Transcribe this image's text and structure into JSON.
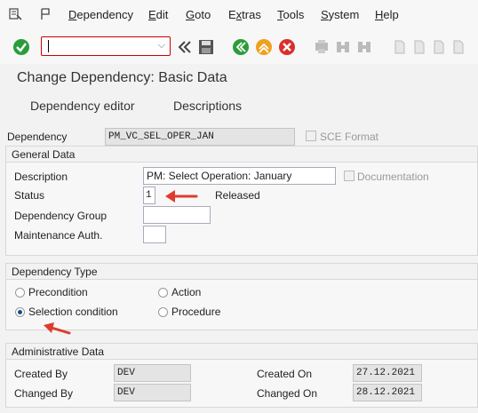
{
  "menubar": {
    "items": [
      "Dependency",
      "Edit",
      "Goto",
      "Extras",
      "Tools",
      "System",
      "Help"
    ],
    "underline": [
      "D",
      "E",
      "G",
      "x",
      "T",
      "S",
      "H"
    ]
  },
  "toolbar": {
    "command_value": "",
    "icons": [
      "enter-icon",
      "back-icon",
      "save-icon",
      "back-green-icon",
      "exit-icon",
      "cancel-icon",
      "find-icon",
      "find-next-icon",
      "page-icons"
    ]
  },
  "title": "Change Dependency: Basic Data",
  "app_toolbar": {
    "buttons": [
      "Dependency editor",
      "Descriptions"
    ]
  },
  "header": {
    "dependency_label": "Dependency",
    "dependency_value": "PM_VC_SEL_OPER_JAN",
    "sce_format_label": "SCE Format"
  },
  "general_data": {
    "title": "General Data",
    "description_label": "Description",
    "description_value": "PM: Select Operation: January",
    "documentation_label": "Documentation",
    "status_label": "Status",
    "status_value": "1",
    "status_text": "Released",
    "dependency_group_label": "Dependency Group",
    "dependency_group_value": "",
    "maintenance_auth_label": "Maintenance Auth.",
    "maintenance_auth_value": ""
  },
  "dependency_type": {
    "title": "Dependency Type",
    "options": [
      {
        "label": "Precondition",
        "selected": false
      },
      {
        "label": "Action",
        "selected": false
      },
      {
        "label": "Selection condition",
        "selected": true
      },
      {
        "label": "Procedure",
        "selected": false
      }
    ]
  },
  "admin_data": {
    "title": "Administrative Data",
    "created_by_label": "Created By",
    "created_by_value": "DEV",
    "changed_by_label": "Changed By",
    "changed_by_value": "DEV",
    "created_on_label": "Created On",
    "created_on_value": "27.12.2021",
    "changed_on_label": "Changed On",
    "changed_on_value": "28.12.2021"
  },
  "colors": {
    "accent_arrow": "#e03a2f",
    "enter_green": "#2a9d3a",
    "cancel_red": "#d9302c",
    "exit_orange": "#f0a020"
  }
}
